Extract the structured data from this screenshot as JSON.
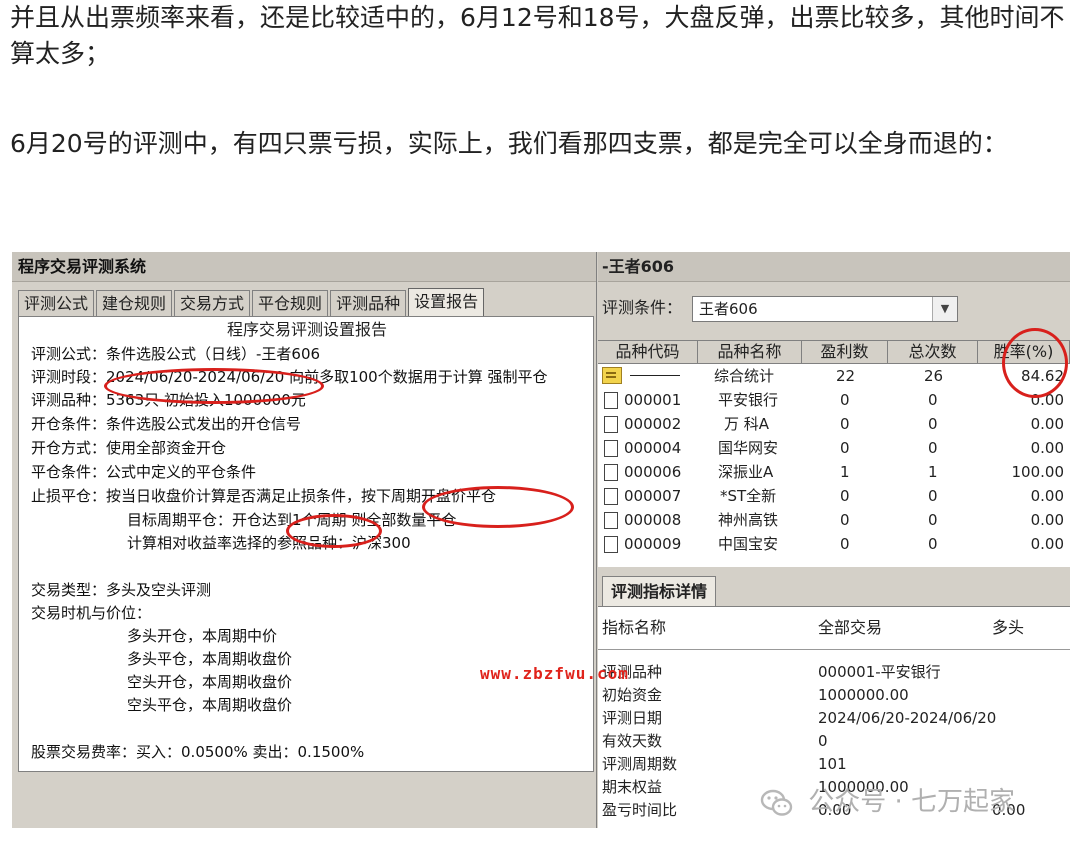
{
  "article": {
    "para1": "并且从出票频率来看，还是比较适中的，6月12号和18号，大盘反弹，出票比较多，其他时间不算太多；",
    "para2": "6月20号的评测中，有四只票亏损，实际上，我们看那四支票，都是完全可以全身而退的："
  },
  "left": {
    "title": "程序交易评测系统",
    "tabs": [
      "评测公式",
      "建仓规则",
      "交易方式",
      "平仓规则",
      "评测品种",
      "设置报告"
    ],
    "active_tab": "设置报告",
    "report": {
      "title": "程序交易评测设置报告",
      "formula": "评测公式：条件选股公式（日线）-王者606",
      "period": "评测时段：2024/06/20-2024/06/20 向前多取100个数据用于计算 强制平仓",
      "symbols": "评测品种：5363只  初始投入1000000元",
      "open_cond": "开仓条件：条件选股公式发出的开仓信号",
      "open_mode": "开仓方式：使用全部资金开仓",
      "close_cond": "平仓条件：公式中定义的平仓条件",
      "stop_loss": "止损平仓：按当日收盘价计算是否满足止损条件，按下周期开盘价平仓",
      "target": "目标周期平仓：开仓达到1个周期 则全部数量平仓",
      "benchmark": "计算相对收益率选择的参照品种：沪深300",
      "trade_type": "交易类型：多头及空头评测",
      "timing": "交易时机与价位：",
      "long_open": "多头开仓，本周期中价",
      "long_close": "多头平仓，本周期收盘价",
      "short_open": "空头开仓，本周期收盘价",
      "short_close": "空头平仓，本周期收盘价",
      "fees": "股票交易费率：买入：0.0500%  卖出：0.1500%"
    }
  },
  "right": {
    "title": "-王者606",
    "cond_label": "评测条件：",
    "cond_value": "王者606",
    "columns": [
      "品种代码",
      "品种名称",
      "盈利数",
      "总次数",
      "胜率(%)"
    ],
    "summary": {
      "name": "综合统计",
      "profit": "22",
      "total": "26",
      "rate": "84.62"
    },
    "rows": [
      {
        "code": "000001",
        "name": "平安银行",
        "profit": "0",
        "total": "0",
        "rate": "0.00"
      },
      {
        "code": "000002",
        "name": "万 科A",
        "profit": "0",
        "total": "0",
        "rate": "0.00"
      },
      {
        "code": "000004",
        "name": "国华网安",
        "profit": "0",
        "total": "0",
        "rate": "0.00"
      },
      {
        "code": "000006",
        "name": "深振业A",
        "profit": "1",
        "total": "1",
        "rate": "100.00"
      },
      {
        "code": "000007",
        "name": "*ST全新",
        "profit": "0",
        "total": "0",
        "rate": "0.00"
      },
      {
        "code": "000008",
        "name": "神州高铁",
        "profit": "0",
        "total": "0",
        "rate": "0.00"
      },
      {
        "code": "000009",
        "name": "中国宝安",
        "profit": "0",
        "total": "0",
        "rate": "0.00"
      }
    ],
    "detail_tab": "评测指标详情",
    "detail_headers": [
      "指标名称",
      "全部交易",
      "多头"
    ],
    "detail_rows": [
      {
        "name": "评测品种",
        "all": "000001-平安银行",
        "long": ""
      },
      {
        "name": "初始资金",
        "all": "1000000.00",
        "long": ""
      },
      {
        "name": "评测日期",
        "all": "2024/06/20-2024/06/20",
        "long": ""
      },
      {
        "name": "有效天数",
        "all": "0",
        "long": ""
      },
      {
        "name": "评测周期数",
        "all": "101",
        "long": ""
      },
      {
        "name": "期末权益",
        "all": "1000000.00",
        "long": ""
      },
      {
        "name": "盈亏时间比",
        "all": "0.00",
        "long": "0.00"
      }
    ]
  },
  "watermarks": {
    "url": "www.zbzfwu.com",
    "account": "公众号 · 七万起家"
  },
  "colors": {
    "highlight": "#d8201c",
    "window_bg": "#d4d0c8"
  }
}
